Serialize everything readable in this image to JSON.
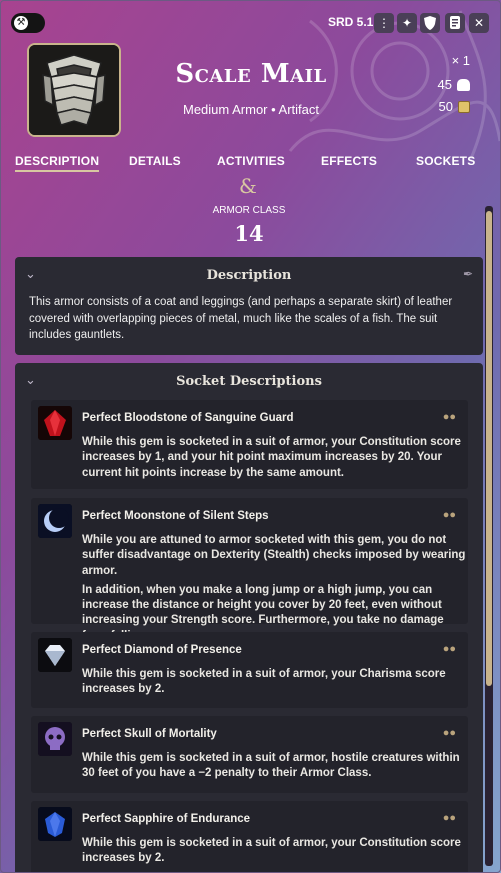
{
  "topbar": {
    "srd_label": "SRD 5.1",
    "icons": [
      "wrench-icon",
      "kebab-menu-icon",
      "magic-wand-icon",
      "shield-icon",
      "scroll-icon",
      "close-icon"
    ]
  },
  "header": {
    "title": "Scale Mail",
    "subtitle": "Medium Armor • Artifact",
    "quantity": "× 1",
    "weight": "45",
    "price": "50"
  },
  "tabs": [
    "DESCRIPTION",
    "DETAILS",
    "ACTIVITIES",
    "EFFECTS",
    "SOCKETS"
  ],
  "active_tab": "DESCRIPTION",
  "divider_glyph": "&",
  "armor": {
    "label": "ARMOR CLASS",
    "value": "14"
  },
  "description": {
    "title": "Description",
    "text": "This armor consists of a coat and leggings (and perhaps a separate skirt) of leather covered with overlapping pieces of metal, much like the scales of a fish. The suit includes gauntlets."
  },
  "sockets": {
    "title": "Socket Descriptions",
    "items": [
      {
        "name": "Perfect Bloodstone of Sanguine Guard",
        "color": "#b3121b",
        "paragraphs": [
          "While this gem is socketed in a suit of armor, your Constitution score increases by 1, and your hit point maximum increases by 20. Your current hit points increase by the same amount."
        ]
      },
      {
        "name": "Perfect Moonstone of Silent Steps",
        "color": "#9bb8f0",
        "paragraphs": [
          "While you are attuned to armor socketed with this gem, you do not suffer disadvantage on Dexterity (Stealth) checks imposed by wearing armor.",
          "In addition, when you make a long jump or a high jump, you can increase the distance or height you cover by 20 feet, even without increasing your Strength score. Furthermore, you take no damage from falling."
        ]
      },
      {
        "name": "Perfect Diamond of Presence",
        "color": "#dfe8f4",
        "paragraphs": [
          "While this gem is socketed in a suit of armor, your Charisma score increases by 2."
        ]
      },
      {
        "name": "Perfect Skull of Mortality",
        "color": "#8c6cc4",
        "paragraphs": [
          "While this gem is socketed in a suit of armor, hostile creatures within 30 feet of you have a −2 penalty to their Armor Class."
        ]
      },
      {
        "name": "Perfect Sapphire of Endurance",
        "color": "#2a5bd6",
        "paragraphs": [
          "While this gem is socketed in a suit of armor, your Constitution score increases by 2."
        ]
      }
    ]
  }
}
